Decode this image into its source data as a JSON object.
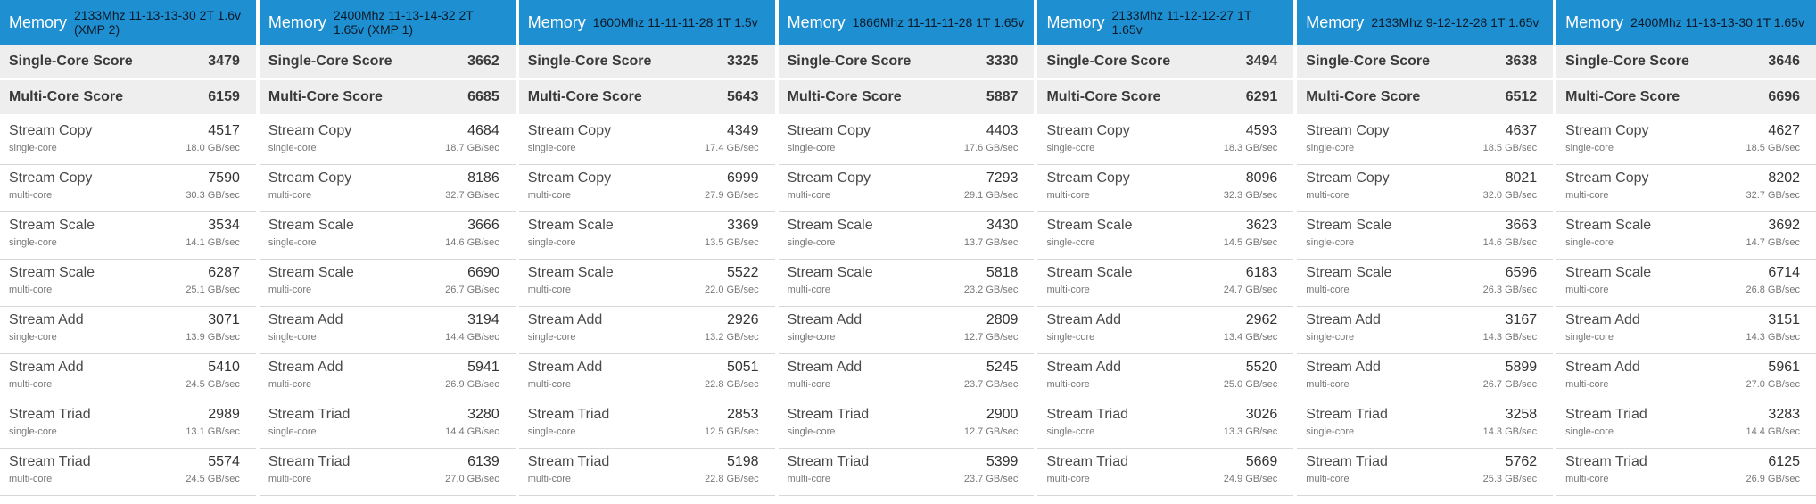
{
  "section_label": "Memory",
  "single_core_label": "Single-Core Score",
  "multi_core_label": "Multi-Core Score",
  "test_labels": [
    "Stream Copy",
    "Stream Copy",
    "Stream Scale",
    "Stream Scale",
    "Stream Add",
    "Stream Add",
    "Stream Triad",
    "Stream Triad"
  ],
  "mode_labels": [
    "single-core",
    "multi-core",
    "single-core",
    "multi-core",
    "single-core",
    "multi-core",
    "single-core",
    "multi-core"
  ],
  "panels": [
    {
      "config": "2133Mhz 11-13-13-30 2T 1.6v (XMP 2)",
      "single_score": "3479",
      "multi_score": "6159",
      "rows": [
        {
          "score": "4517",
          "rate": "18.0 GB/sec"
        },
        {
          "score": "7590",
          "rate": "30.3 GB/sec"
        },
        {
          "score": "3534",
          "rate": "14.1 GB/sec"
        },
        {
          "score": "6287",
          "rate": "25.1 GB/sec"
        },
        {
          "score": "3071",
          "rate": "13.9 GB/sec"
        },
        {
          "score": "5410",
          "rate": "24.5 GB/sec"
        },
        {
          "score": "2989",
          "rate": "13.1 GB/sec"
        },
        {
          "score": "5574",
          "rate": "24.5 GB/sec"
        }
      ]
    },
    {
      "config": "2400Mhz 11-13-14-32 2T 1.65v (XMP 1)",
      "single_score": "3662",
      "multi_score": "6685",
      "rows": [
        {
          "score": "4684",
          "rate": "18.7 GB/sec"
        },
        {
          "score": "8186",
          "rate": "32.7 GB/sec"
        },
        {
          "score": "3666",
          "rate": "14.6 GB/sec"
        },
        {
          "score": "6690",
          "rate": "26.7 GB/sec"
        },
        {
          "score": "3194",
          "rate": "14.4 GB/sec"
        },
        {
          "score": "5941",
          "rate": "26.9 GB/sec"
        },
        {
          "score": "3280",
          "rate": "14.4 GB/sec"
        },
        {
          "score": "6139",
          "rate": "27.0 GB/sec"
        }
      ]
    },
    {
      "config": "1600Mhz 11-11-11-28 1T 1.5v",
      "single_score": "3325",
      "multi_score": "5643",
      "rows": [
        {
          "score": "4349",
          "rate": "17.4 GB/sec"
        },
        {
          "score": "6999",
          "rate": "27.9 GB/sec"
        },
        {
          "score": "3369",
          "rate": "13.5 GB/sec"
        },
        {
          "score": "5522",
          "rate": "22.0 GB/sec"
        },
        {
          "score": "2926",
          "rate": "13.2 GB/sec"
        },
        {
          "score": "5051",
          "rate": "22.8 GB/sec"
        },
        {
          "score": "2853",
          "rate": "12.5 GB/sec"
        },
        {
          "score": "5198",
          "rate": "22.8 GB/sec"
        }
      ]
    },
    {
      "config": "1866Mhz 11-11-11-28 1T 1.65v",
      "single_score": "3330",
      "multi_score": "5887",
      "rows": [
        {
          "score": "4403",
          "rate": "17.6 GB/sec"
        },
        {
          "score": "7293",
          "rate": "29.1 GB/sec"
        },
        {
          "score": "3430",
          "rate": "13.7 GB/sec"
        },
        {
          "score": "5818",
          "rate": "23.2 GB/sec"
        },
        {
          "score": "2809",
          "rate": "12.7 GB/sec"
        },
        {
          "score": "5245",
          "rate": "23.7 GB/sec"
        },
        {
          "score": "2900",
          "rate": "12.7 GB/sec"
        },
        {
          "score": "5399",
          "rate": "23.7 GB/sec"
        }
      ]
    },
    {
      "config": "2133Mhz 11-12-12-27 1T 1.65v",
      "single_score": "3494",
      "multi_score": "6291",
      "rows": [
        {
          "score": "4593",
          "rate": "18.3 GB/sec"
        },
        {
          "score": "8096",
          "rate": "32.3 GB/sec"
        },
        {
          "score": "3623",
          "rate": "14.5 GB/sec"
        },
        {
          "score": "6183",
          "rate": "24.7 GB/sec"
        },
        {
          "score": "2962",
          "rate": "13.4 GB/sec"
        },
        {
          "score": "5520",
          "rate": "25.0 GB/sec"
        },
        {
          "score": "3026",
          "rate": "13.3 GB/sec"
        },
        {
          "score": "5669",
          "rate": "24.9 GB/sec"
        }
      ]
    },
    {
      "config": "2133Mhz 9-12-12-28 1T 1.65v",
      "single_score": "3638",
      "multi_score": "6512",
      "rows": [
        {
          "score": "4637",
          "rate": "18.5 GB/sec"
        },
        {
          "score": "8021",
          "rate": "32.0 GB/sec"
        },
        {
          "score": "3663",
          "rate": "14.6 GB/sec"
        },
        {
          "score": "6596",
          "rate": "26.3 GB/sec"
        },
        {
          "score": "3167",
          "rate": "14.3 GB/sec"
        },
        {
          "score": "5899",
          "rate": "26.7 GB/sec"
        },
        {
          "score": "3258",
          "rate": "14.3 GB/sec"
        },
        {
          "score": "5762",
          "rate": "25.3 GB/sec"
        }
      ]
    },
    {
      "config": "2400Mhz 11-13-13-30 1T 1.65v",
      "single_score": "3646",
      "multi_score": "6696",
      "rows": [
        {
          "score": "4627",
          "rate": "18.5 GB/sec"
        },
        {
          "score": "8202",
          "rate": "32.7 GB/sec"
        },
        {
          "score": "3692",
          "rate": "14.7 GB/sec"
        },
        {
          "score": "6714",
          "rate": "26.8 GB/sec"
        },
        {
          "score": "3151",
          "rate": "14.3 GB/sec"
        },
        {
          "score": "5961",
          "rate": "27.0 GB/sec"
        },
        {
          "score": "3283",
          "rate": "14.4 GB/sec"
        },
        {
          "score": "6125",
          "rate": "26.9 GB/sec"
        }
      ]
    }
  ]
}
